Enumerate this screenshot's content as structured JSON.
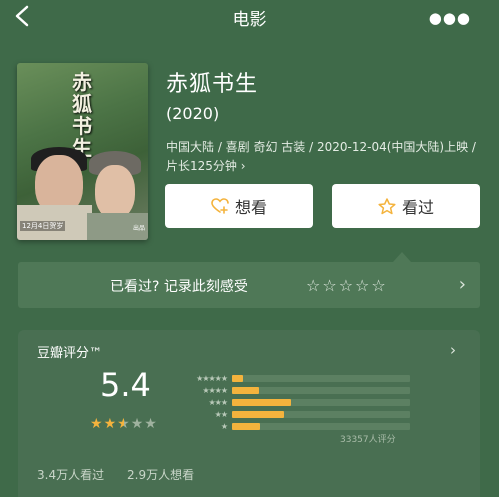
{
  "topbar": {
    "title": "电影",
    "back_icon": "back-chevron-icon",
    "more_icon": "more-dots-icon"
  },
  "poster": {
    "title_text": "赤狐书生",
    "date_text": "12月4日贺岁",
    "studio_text": "出品"
  },
  "movie": {
    "title": "赤狐书生",
    "year": "(2020)",
    "meta": "中国大陆 / 喜剧 奇幻 古装 / 2020-12-04(中国大陆)上映 / 片长125分钟",
    "meta_arrow": "›"
  },
  "actions": {
    "want_label": "想看",
    "seen_label": "看过"
  },
  "rate_prompt": {
    "text": "已看过? 记录此刻感受",
    "stars": "☆☆☆☆☆",
    "arrow": "›"
  },
  "rating": {
    "title": "豆瓣评分™",
    "arrow": "›",
    "score": "5.4",
    "score_stars": 2.5,
    "distribution": [
      {
        "stars": "★★★★★",
        "fraction": 0.06
      },
      {
        "stars": "★★★★",
        "fraction": 0.15
      },
      {
        "stars": "★★★",
        "fraction": 0.33
      },
      {
        "stars": "★★",
        "fraction": 0.29
      },
      {
        "stars": "★",
        "fraction": 0.16
      }
    ],
    "count_text": "33357人评分",
    "watched_text": "3.4万人看过",
    "want_text": "2.9万人想看"
  },
  "colors": {
    "background": "#3f6a49",
    "accent_star": "#f4b33d",
    "button_bg": "#ffffff"
  }
}
